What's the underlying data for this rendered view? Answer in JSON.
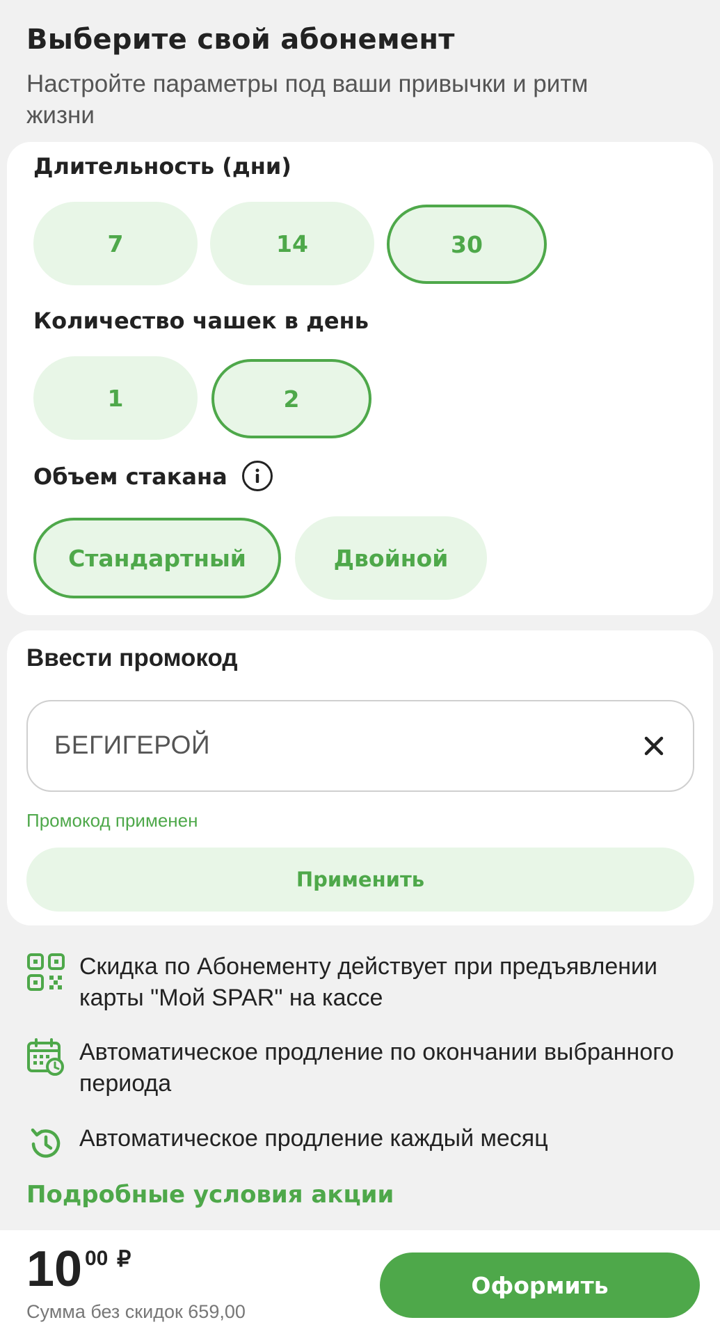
{
  "header": {
    "title": "Выберите свой абонемент",
    "subtitle": "Настройте параметры под ваши привычки и ритм жизни"
  },
  "options": {
    "duration": {
      "label": "Длительность (дни)",
      "choices": [
        "7",
        "14",
        "30"
      ],
      "selected": "30"
    },
    "cups": {
      "label": "Количество чашек в день",
      "choices": [
        "1",
        "2"
      ],
      "selected": "2"
    },
    "volume": {
      "label": "Объем стакана",
      "info_icon": "info-icon",
      "choices": [
        "Стандартный",
        "Двойной"
      ],
      "selected": "Стандартный"
    }
  },
  "promo": {
    "title": "Ввести промокод",
    "value": "БЕГИГЕРОЙ",
    "status": "Промокод применен",
    "apply_label": "Применить"
  },
  "benefits": [
    {
      "icon": "qr-code-icon",
      "text": "Скидка по Абонементу действует при предъявлении карты \"Мой SPAR\" на кассе"
    },
    {
      "icon": "calendar-clock-icon",
      "text": "Автоматическое продление по окончании выбранного периода"
    },
    {
      "icon": "history-icon",
      "text": "Автоматическое продление каждый месяц"
    }
  ],
  "terms_link": "Подробные условия акции",
  "footer": {
    "price_main": "10",
    "price_frac": "00",
    "currency": "₽",
    "price_note": "Сумма без скидок 659,00",
    "order_label": "Оформить"
  },
  "colors": {
    "accent": "#4ea84a",
    "pill_bg": "#e8f6e7",
    "page_bg": "#f1f1f1"
  }
}
